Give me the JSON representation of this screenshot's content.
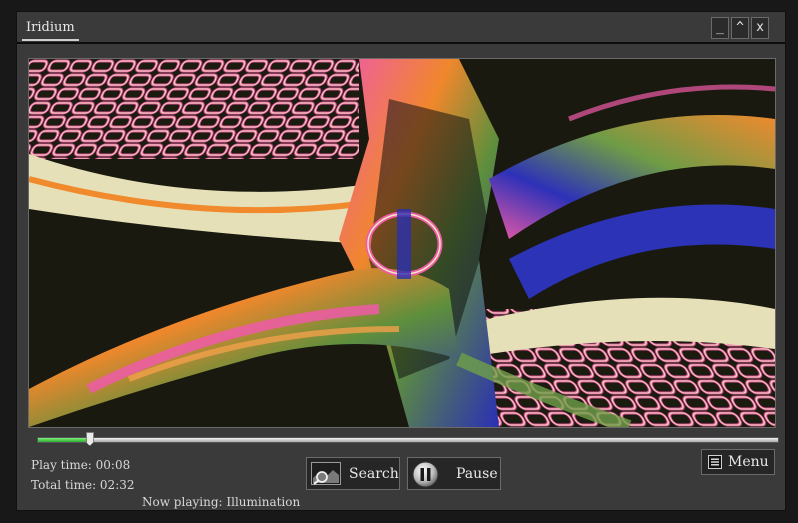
{
  "window": {
    "title": "Iridium",
    "minimize_label": "_",
    "maximize_label": "^",
    "close_label": "x"
  },
  "player": {
    "progress": 0.07,
    "play_time": "Play time: 00:08",
    "total_time": "Total time: 02:32",
    "now_playing": "Now playing: Illumination"
  },
  "controls": {
    "search_label": "Search",
    "pause_label": "Pause",
    "menu_label": "Menu"
  },
  "icons": {
    "search": "image-search-icon",
    "pause": "pause-icon",
    "menu": "hamburger-menu-icon"
  },
  "colors": {
    "window_bg": "#3a3a3a",
    "progress_fill": "#3fcf3f"
  }
}
